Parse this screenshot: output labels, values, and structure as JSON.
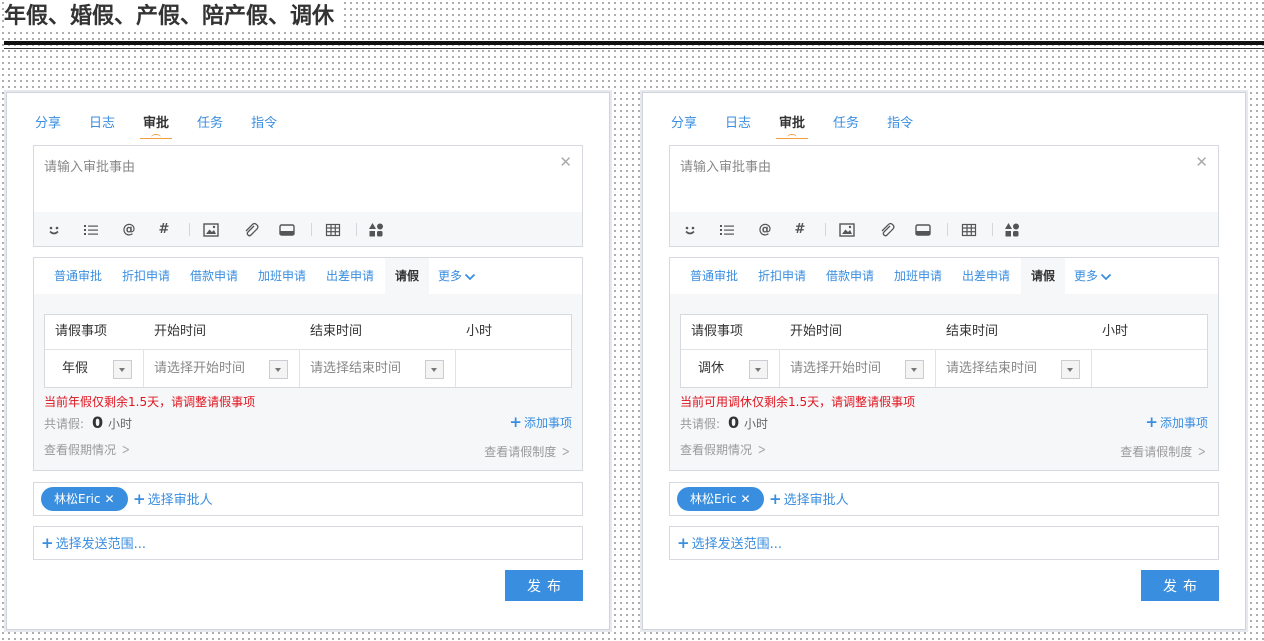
{
  "page": {
    "title": "年假、婚假、产假、陪产假、调休"
  },
  "colors": {
    "accent": "#3a8ee0",
    "warning": "#e0141e",
    "tab_indicator": "#f39c3d"
  },
  "cards": [
    {
      "tabs": [
        "分享",
        "日志",
        "审批",
        "任务",
        "指令"
      ],
      "active_tab": "审批",
      "editor": {
        "placeholder": "请输入审批事由"
      },
      "toolbar_icons": [
        "emoji-icon",
        "list-icon",
        "at-icon",
        "hashtag-icon",
        "image-icon",
        "attachment-icon",
        "card-icon",
        "table-icon",
        "apps-icon"
      ],
      "approval_types": [
        "普通审批",
        "折扣申请",
        "借款申请",
        "加班申请",
        "出差申请",
        "请假",
        "更多"
      ],
      "active_type": "请假",
      "table": {
        "headers": [
          "请假事项",
          "开始时间",
          "结束时间",
          "小时"
        ],
        "leave_type": "年假",
        "start_placeholder": "请选择开始时间",
        "end_placeholder": "请选择结束时间"
      },
      "warning": "当前年假仅剩余1.5天，请调整请假事项",
      "total_label": "共请假:",
      "total_value": "0",
      "total_unit": "小时",
      "add_item": "添加事项",
      "view_balance": "查看假期情况",
      "view_policy": "查看请假制度",
      "approver_chip": "林松Eric",
      "select_approver": "选择审批人",
      "select_scope": "选择发送范围...",
      "publish": "发布"
    },
    {
      "tabs": [
        "分享",
        "日志",
        "审批",
        "任务",
        "指令"
      ],
      "active_tab": "审批",
      "editor": {
        "placeholder": "请输入审批事由"
      },
      "toolbar_icons": [
        "emoji-icon",
        "list-icon",
        "at-icon",
        "hashtag-icon",
        "image-icon",
        "attachment-icon",
        "card-icon",
        "table-icon",
        "apps-icon"
      ],
      "approval_types": [
        "普通审批",
        "折扣申请",
        "借款申请",
        "加班申请",
        "出差申请",
        "请假",
        "更多"
      ],
      "active_type": "请假",
      "table": {
        "headers": [
          "请假事项",
          "开始时间",
          "结束时间",
          "小时"
        ],
        "leave_type": "调休",
        "start_placeholder": "请选择开始时间",
        "end_placeholder": "请选择结束时间"
      },
      "warning": "当前可用调休仅剩余1.5天，请调整请假事项",
      "total_label": "共请假:",
      "total_value": "0",
      "total_unit": "小时",
      "add_item": "添加事项",
      "view_balance": "查看假期情况",
      "view_policy": "查看请假制度",
      "approver_chip": "林松Eric",
      "select_approver": "选择审批人",
      "select_scope": "选择发送范围...",
      "publish": "发布"
    }
  ]
}
